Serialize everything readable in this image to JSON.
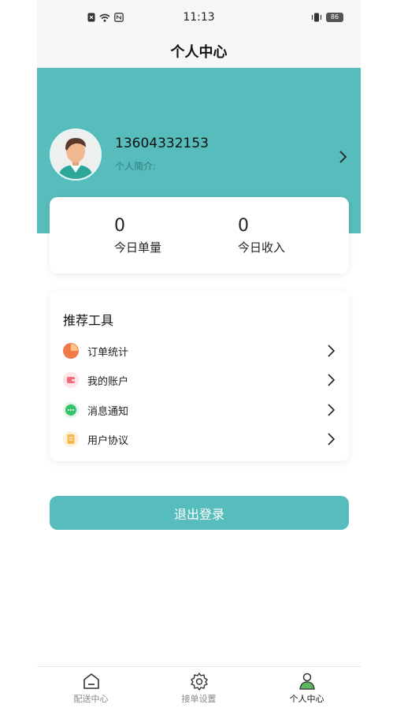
{
  "status_bar": {
    "time": "11:13",
    "battery": "86"
  },
  "header": {
    "title": "个人中心"
  },
  "profile": {
    "phone": "13604332153",
    "intro_label": "个人简介:"
  },
  "stats": [
    {
      "value": "0",
      "label": "今日单量"
    },
    {
      "value": "0",
      "label": "今日收入"
    }
  ],
  "tools": {
    "title": "推荐工具",
    "items": [
      {
        "label": "订单统计",
        "icon": "pie-chart-icon",
        "color": "#f07a4a"
      },
      {
        "label": "我的账户",
        "icon": "wallet-icon",
        "color": "#f26b7a"
      },
      {
        "label": "消息通知",
        "icon": "chat-bubble-icon",
        "color": "#35c46a"
      },
      {
        "label": "用户协议",
        "icon": "document-icon",
        "color": "#f5b94a"
      }
    ]
  },
  "logout": {
    "label": "退出登录"
  },
  "tabbar": {
    "tabs": [
      {
        "label": "配送中心",
        "icon": "home-icon"
      },
      {
        "label": "接单设置",
        "icon": "settings-gear-icon"
      },
      {
        "label": "个人中心",
        "icon": "user-icon",
        "active": true
      }
    ]
  },
  "colors": {
    "primary": "#56bcbc",
    "header_bg": "#f7f7f7"
  }
}
